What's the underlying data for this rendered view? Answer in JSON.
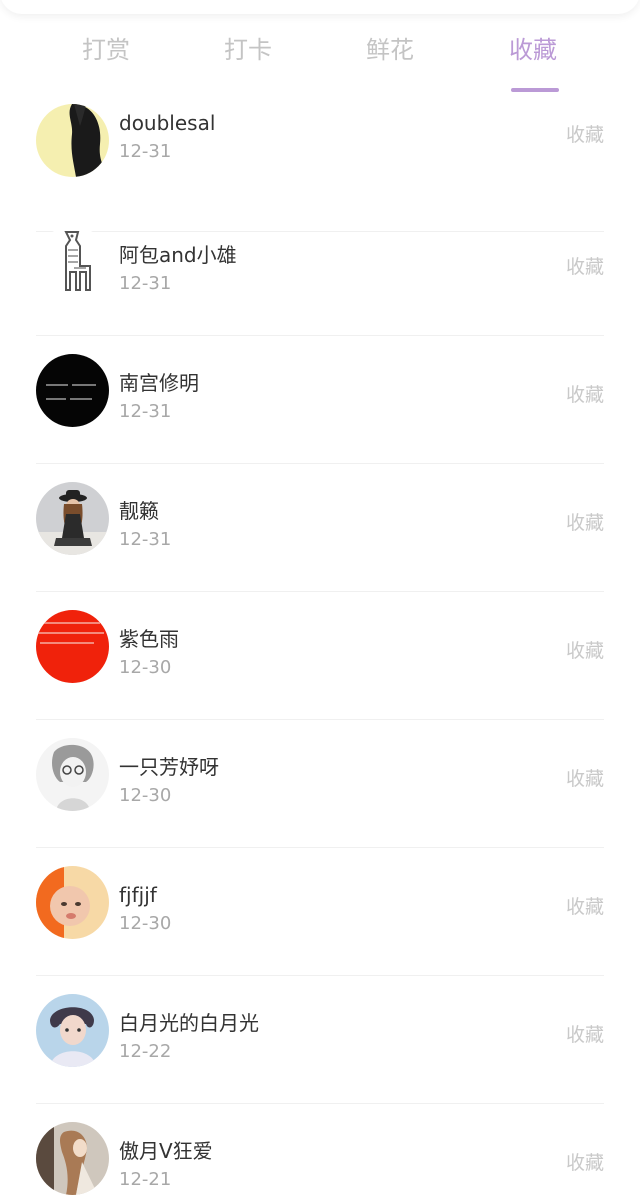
{
  "tabs": [
    {
      "label": "打赏"
    },
    {
      "label": "打卡"
    },
    {
      "label": "鲜花"
    },
    {
      "label": "收藏"
    }
  ],
  "active_tab_index": 3,
  "colors": {
    "accent": "#bb9ad6",
    "inactive_tab": "#c4c4c4",
    "name_text": "#333333",
    "date_text": "#a8a8a8",
    "action_text": "#c9c9c9"
  },
  "list": {
    "items": [
      {
        "name": "doublesal",
        "date": "12-31",
        "action": "收藏",
        "avatar": "avatar-yellow-longhair"
      },
      {
        "name": "阿包and小雄",
        "date": "12-31",
        "action": "收藏",
        "avatar": "avatar-giraffe"
      },
      {
        "name": "南宫修明",
        "date": "12-31",
        "action": "收藏",
        "avatar": "avatar-black-text"
      },
      {
        "name": "靓籁",
        "date": "12-31",
        "action": "收藏",
        "avatar": "avatar-hat-woman"
      },
      {
        "name": "紫色雨",
        "date": "12-30",
        "action": "收藏",
        "avatar": "avatar-red-text"
      },
      {
        "name": "一只芳妤呀",
        "date": "12-30",
        "action": "收藏",
        "avatar": "avatar-sketch-boy"
      },
      {
        "name": "fjfjjf",
        "date": "12-30",
        "action": "收藏",
        "avatar": "avatar-orange-baby"
      },
      {
        "name": "白月光的白月光",
        "date": "12-22",
        "action": "收藏",
        "avatar": "avatar-blue-boy"
      },
      {
        "name": "傲月V狂爱",
        "date": "12-21",
        "action": "收藏",
        "avatar": "avatar-braid-girl"
      }
    ]
  }
}
